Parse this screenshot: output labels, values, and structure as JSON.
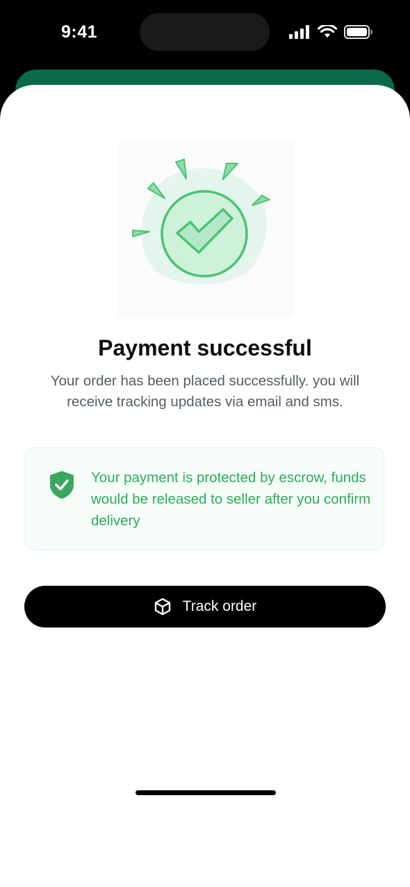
{
  "status_bar": {
    "time": "9:41",
    "icons": [
      "cellular-signal-icon",
      "wifi-icon",
      "battery-icon"
    ]
  },
  "illustration": {
    "icon": "success-checkmark-icon",
    "accent": "#4cc273",
    "blob": "#e3f5ec"
  },
  "payment": {
    "title": "Payment successful",
    "subtitle": "Your order has been placed successfully. you will receive tracking updates via email and sms."
  },
  "escrow": {
    "icon": "shield-check-icon",
    "message": "Your payment is protected by escrow, funds would be released to seller after you confirm delivery",
    "text_color": "#2cab5c"
  },
  "actions": {
    "track_order_label": "Track order",
    "track_order_icon": "package-box-icon"
  },
  "colors": {
    "header_green": "#0b6a4a",
    "button_bg": "#000000"
  }
}
